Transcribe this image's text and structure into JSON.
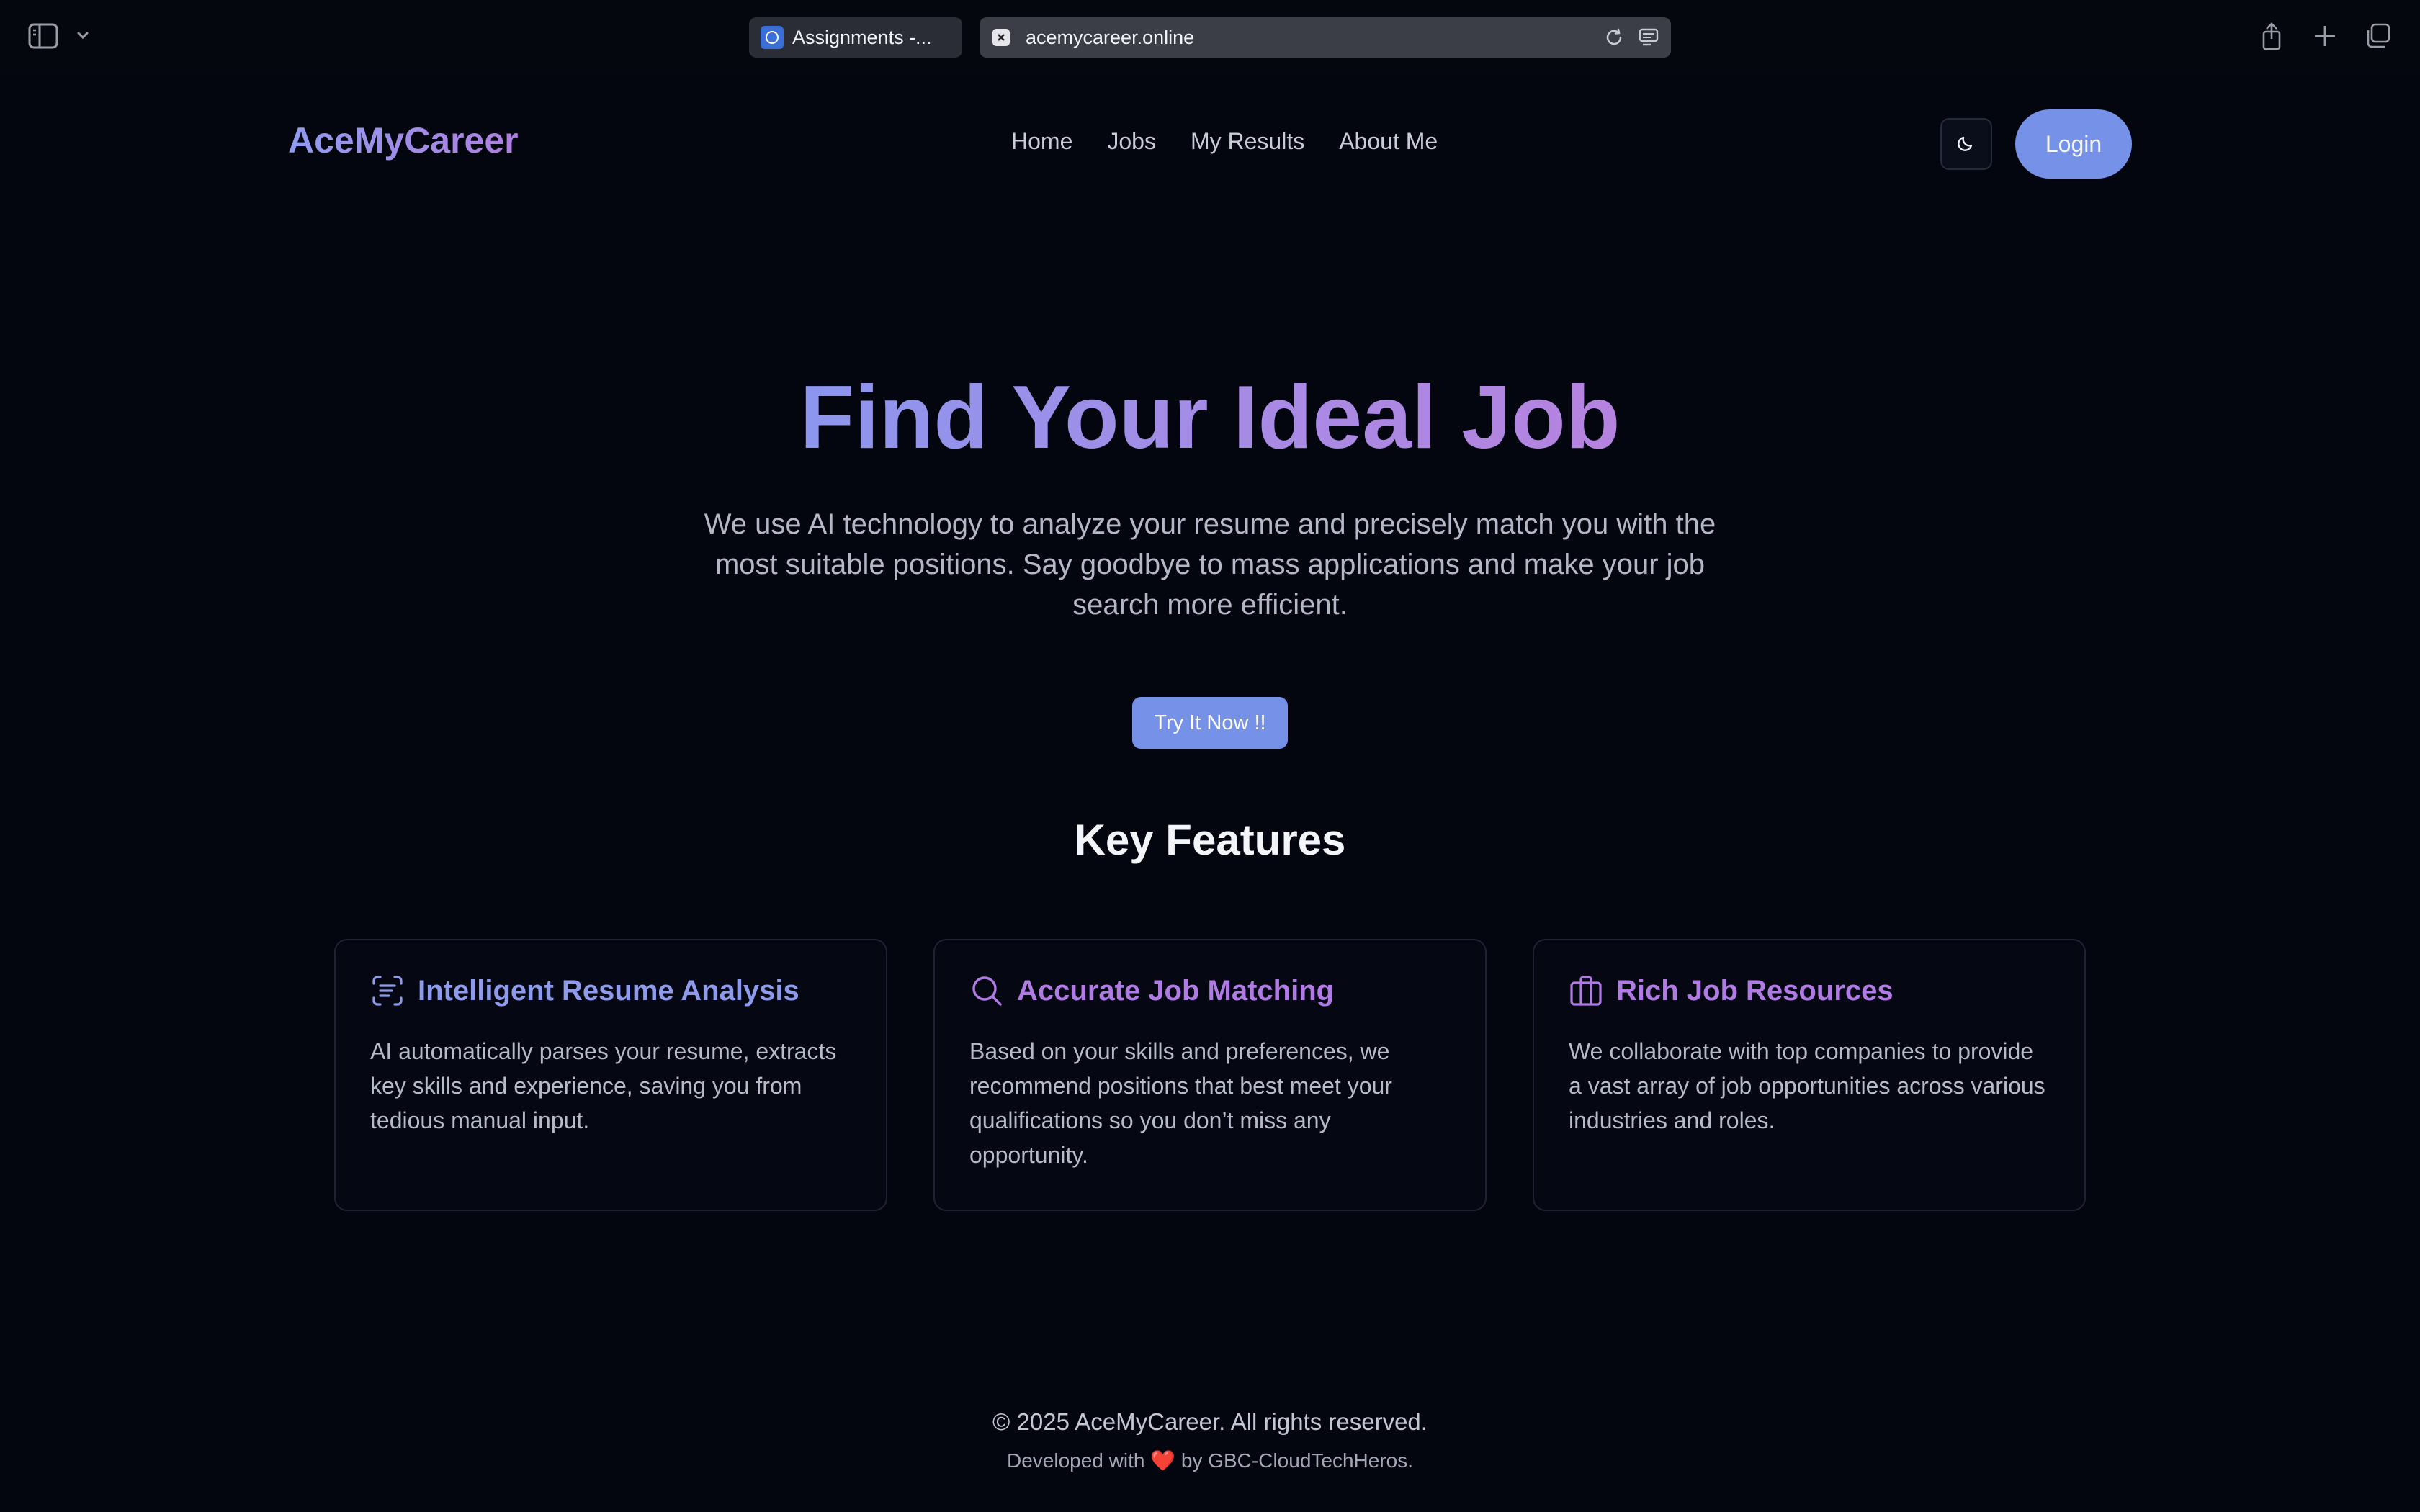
{
  "browser": {
    "tabs": [
      {
        "label": "Assignments -..."
      },
      {
        "label": "acemycareer.online"
      }
    ]
  },
  "header": {
    "brand": "AceMyCareer",
    "nav": [
      "Home",
      "Jobs",
      "My Results",
      "About Me"
    ],
    "login_label": "Login"
  },
  "hero": {
    "title": "Find Your Ideal Job",
    "subtitle": "We use AI technology to analyze your resume and precisely match you with the most suitable positions. Say goodbye to mass applications and make your job search more efficient.",
    "cta_label": "Try It Now !!"
  },
  "features": {
    "title": "Key Features",
    "cards": [
      {
        "icon": "scan-text-icon",
        "title": "Intelligent Resume Analysis",
        "body": "AI automatically parses your resume, extracts key skills and experience, saving you from tedious manual input."
      },
      {
        "icon": "search-icon",
        "title": "Accurate Job Matching",
        "body": "Based on your skills and preferences, we recommend positions that best meet your qualifications so you don’t miss any opportunity."
      },
      {
        "icon": "briefcase-icon",
        "title": "Rich Job Resources",
        "body": "We collaborate with top companies to provide a vast array of job opportunities across various industries and roles."
      }
    ]
  },
  "footer": {
    "copyright": "© 2025 AceMyCareer. All rights reserved.",
    "developed_prefix": "Developed with",
    "developed_suffix": "by GBC-CloudTechHeros."
  },
  "colors": {
    "accent": "#7691e8",
    "brand_gradient_start": "#8c96ee",
    "brand_gradient_end": "#b583df",
    "background": "#03050f"
  }
}
